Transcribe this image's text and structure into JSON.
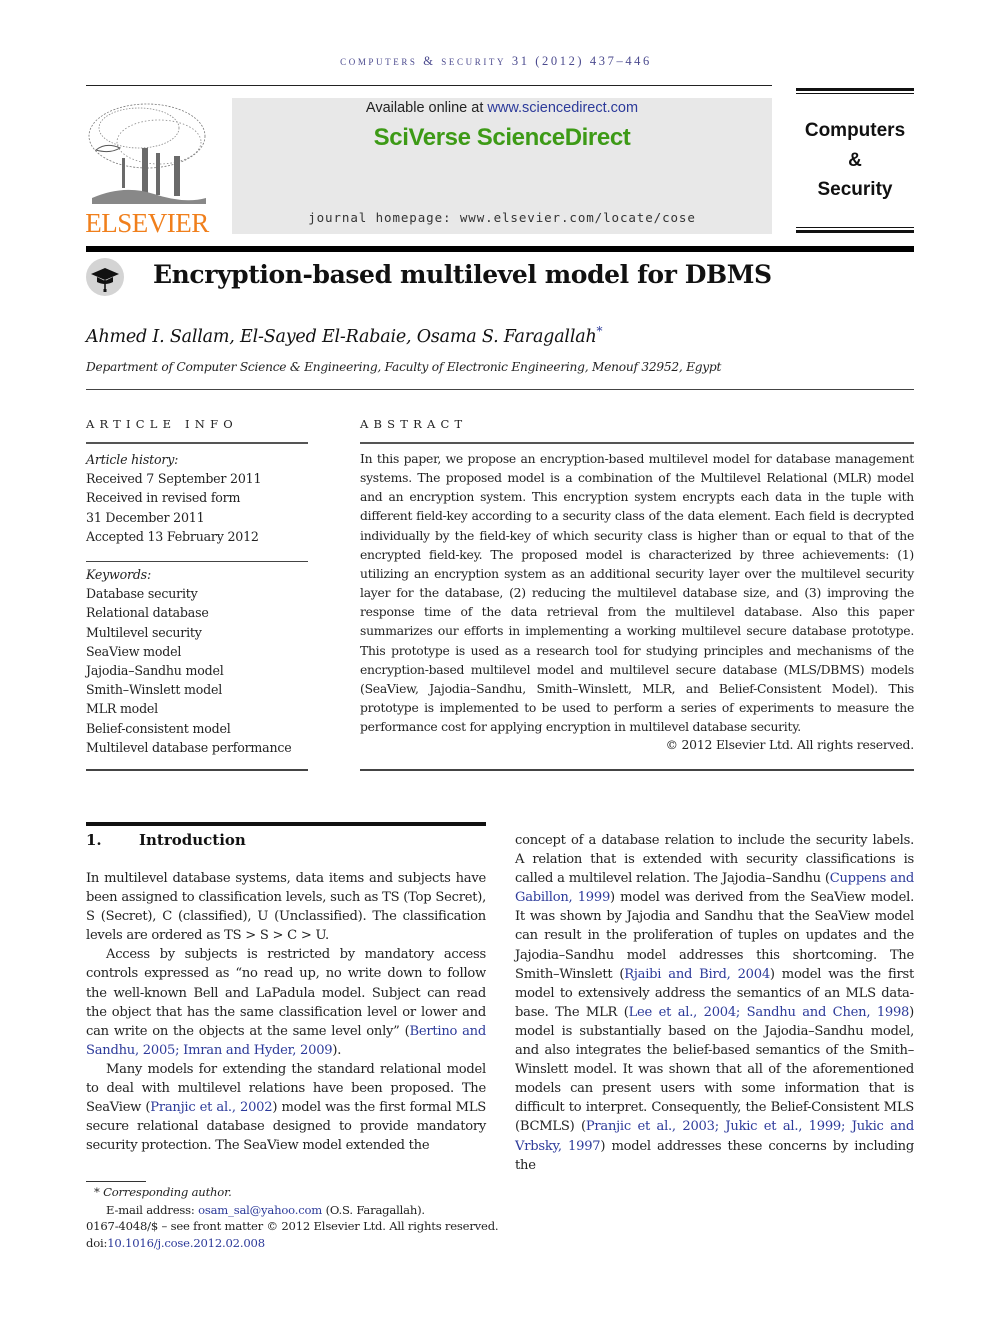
{
  "running_head": "computers & security 31 (2012) 437–446",
  "publisher": {
    "name": "ELSEVIER",
    "logo_icon": "elsevier-tree-icon",
    "brand_color": "#f07f1c"
  },
  "sciencedirect": {
    "available_prefix": "Available online at ",
    "available_link": "www.sciencedirect.com",
    "brand": "SciVerse ScienceDirect",
    "brand_color": "#3d9a16",
    "homepage": "journal homepage: www.elsevier.com/locate/cose"
  },
  "journal": {
    "line1": "Computers",
    "line2": "&",
    "line3": "Security"
  },
  "article": {
    "icon": "graduation-cap-icon",
    "title": "Encryption-based multilevel model for DBMS",
    "authors": "Ahmed I. Sallam, El-Sayed El-Rabaie, Osama S. Faragallah",
    "author_mark": "*",
    "affiliation": "Department of Computer Science & Engineering, Faculty of Electronic Engineering, Menouf 32952, Egypt"
  },
  "article_info": {
    "heading": "ARTICLE INFO",
    "history_label": "Article history:",
    "history": [
      "Received 7 September 2011",
      "Received in revised form",
      "31 December 2011",
      "Accepted 13 February 2012"
    ],
    "keywords_label": "Keywords:",
    "keywords": [
      "Database security",
      "Relational database",
      "Multilevel security",
      "SeaView model",
      "Jajodia–Sandhu model",
      "Smith–Winslett model",
      "MLR model",
      "Belief-consistent model",
      "Multilevel database performance"
    ]
  },
  "abstract": {
    "heading": "ABSTRACT",
    "text": "In this paper, we propose an encryption-based multilevel model for database management systems. The proposed model is a combination of the Multilevel Relational (MLR) model and an encryption system. This encryption system encrypts each data in the tuple with different field-key according to a security class of the data element. Each field is decrypted individually by the field-key of which security class is higher than or equal to that of the encrypted field-key. The proposed model is characterized by three achievements: (1) utilizing an encryption system as an additional security layer over the multilevel security layer for the database, (2) reducing the multilevel database size, and (3) improving the response time of the data retrieval from the multilevel database. Also this paper summarizes our efforts in implementing a working multilevel secure database prototype. This prototype is used as a research tool for studying principles and mechanisms of the encryption-based multilevel model and multilevel secure database (MLS/DBMS) models (SeaView, Jajodia–Sandhu, Smith–Winslett, MLR, and Belief-Consistent Model). This prototype is implemented to be used to perform a series of experiments to measure the performance cost for applying encryption in multilevel database security.",
    "copyright": "© 2012 Elsevier Ltd. All rights reserved."
  },
  "intro": {
    "number": "1.",
    "title": "Introduction",
    "p1": "In multilevel database systems, data items and subjects have been assigned to classification levels, such as TS (Top Secret), S (Secret), C (classified), U (Unclassified). The classification levels are ordered as TS > S > C > U.",
    "p2_text": "Access by subjects is restricted by mandatory access controls expressed as “no read up, no write down to follow the well-known Bell and LaPadula model. Subject can read the object that has the same classification level or lower and can write on the objects at the same level only” (",
    "p2_cite": "Bertino and Sandhu, 2005; Imran and Hyder, 2009",
    "p2_end": ").",
    "p3_a": "Many models for extending the standard relational model to deal with multilevel relations have been proposed. The SeaView (",
    "p3_cite1": "Pranjic et al., 2002",
    "p3_b": ") model was the first formal MLS secure relational database designed to provide manda­tory security protection. The SeaView model extended the concept of a database relation to include the security labels. A relation that is extended with security classifications is called a multilevel relation. The Jajodia–Sandhu (",
    "p3_cite2": "Cuppens and Gabillon, 1999",
    "p3_c": ") model was derived from the SeaView model. It was shown by Jajodia and Sandhu that the SeaView model can result in the proliferation of tuples on updates and the Jajodia–Sandhu model addresses this shortcoming. The Smith–Winslett (",
    "p3_cite3": "Rjaibi and Bird, 2004",
    "p3_d": ") model was the first model to extensively address the semantics of an MLS data­base. The MLR (",
    "p3_cite4": "Lee et al., 2004; Sandhu and Chen, 1998",
    "p3_e": ") model is substantially based on the Jajodia–Sandhu model, and also integrates the belief-based semantics of the Smith–Winslett model. It was shown that all of the aforementioned models can present users with some information that is difficult to interpret. Consequently, the Belief-Consistent MLS (BCMLS) (",
    "p3_cite5": "Pranjic et al., 2003; Jukic et al., 1999; Jukic and Vrbsky, 1997",
    "p3_f": ") model addresses these concerns by including the"
  },
  "footnotes": {
    "corresponding": "* Corresponding author.",
    "email_label": "E-mail address: ",
    "email": "osam_sal@yahoo.com",
    "email_owner": " (O.S. Faragallah).",
    "issn": "0167-4048/$ – see front matter © 2012 Elsevier Ltd. All rights reserved.",
    "doi_label": "doi:",
    "doi": "10.1016/j.cose.2012.02.008"
  },
  "colors": {
    "link": "#2c3a9a",
    "running_head": "#4b4a8e",
    "banner_bg": "#e8e8e8"
  }
}
